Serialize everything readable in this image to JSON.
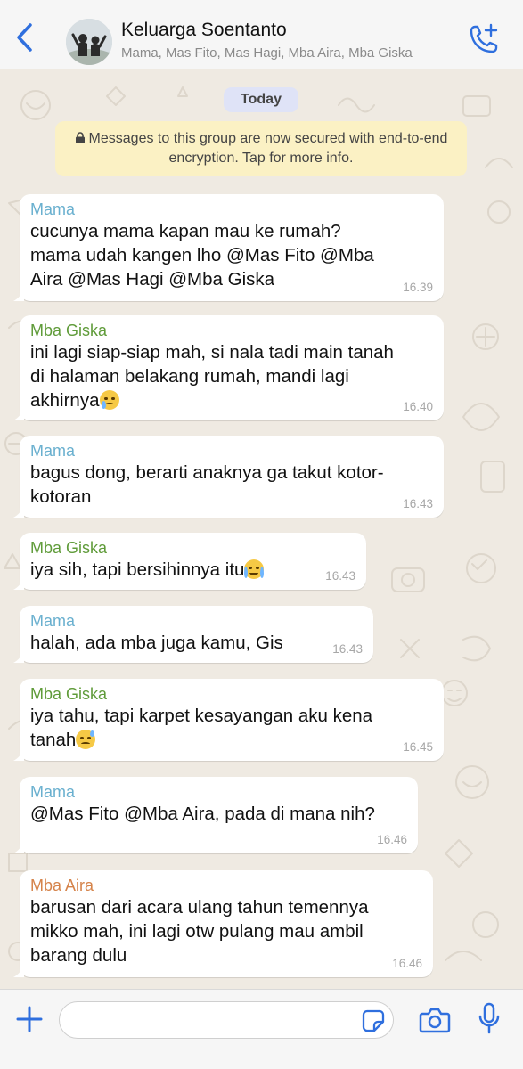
{
  "header": {
    "title": "Keluarga Soentanto",
    "subtitle": "Mama, Mas Fito, Mas Hagi, Mba Aira, Mba Giska"
  },
  "chat": {
    "date_chip": "Today",
    "encryption_notice": "Messages to this group are now secured with end-to-end encryption. Tap for more info.",
    "messages": [
      {
        "sender": "Mama",
        "text": "cucunya mama kapan mau ke rumah? mama udah kangen lho @Mas Fito @Mba Aira @Mas Hagi @Mba Giska",
        "time": "16.39"
      },
      {
        "sender": "Mba Giska",
        "text": "ini lagi siap-siap mah, si nala tadi main tanah di halaman belakang rumah, mandi lagi akhirnya",
        "emoji": "crying-face",
        "time": "16.40"
      },
      {
        "sender": "Mama",
        "text": "bagus dong, berarti anaknya ga takut kotor-kotoran",
        "time": "16.43"
      },
      {
        "sender": "Mba Giska",
        "text": "iya sih, tapi bersihinnya itu",
        "emoji": "loudly-crying-face",
        "time": "16.43"
      },
      {
        "sender": "Mama",
        "text": "halah, ada mba juga kamu, Gis",
        "time": "16.43"
      },
      {
        "sender": "Mba Giska",
        "text": "iya tahu, tapi karpet kesayangan aku kena tanah",
        "emoji": "sad-sweat-face",
        "time": "16.45"
      },
      {
        "sender": "Mama",
        "text": "@Mas Fito @Mba Aira, pada di mana nih?",
        "time": "16.46"
      },
      {
        "sender": "Mba Aira",
        "text": "barusan dari acara ulang tahun temennya mikko mah, ini lagi otw pulang mau ambil barang dulu",
        "time": "16.46"
      }
    ]
  },
  "colors": {
    "accent": "#2f6fde",
    "sender_mama": "#6ab0cf",
    "sender_giska": "#5f9b39",
    "sender_aira": "#d5834a",
    "chat_background": "#efeae2",
    "notice_background": "#fbf1c4",
    "date_chip_background": "#dfe3f7"
  },
  "input": {
    "value": "",
    "placeholder": ""
  },
  "icons": {
    "back": "chevron-left-icon",
    "add_call": "add-call-icon",
    "plus": "plus-icon",
    "sticker": "sticker-icon",
    "camera": "camera-icon",
    "mic": "microphone-icon",
    "lock": "lock-icon"
  }
}
